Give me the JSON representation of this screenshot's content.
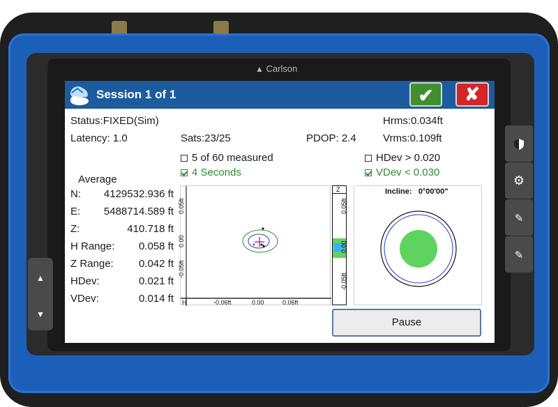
{
  "device": {
    "brand": "Carlson"
  },
  "titlebar": {
    "title": "Session 1 of 1"
  },
  "status": {
    "status": "Status:FIXED(Sim)",
    "latency": "Latency: 1.0",
    "sats": "Sats:23/25",
    "pdop": "PDOP: 2.4",
    "hrms": "Hrms:0.034ft",
    "vrms": "Vrms:0.109ft"
  },
  "criteria": {
    "measured": {
      "label": "5 of 60 measured",
      "checked": false
    },
    "seconds": {
      "label": "4 Seconds",
      "checked": true
    },
    "hdev": {
      "label": "HDev > 0.020",
      "checked": false
    },
    "vdev": {
      "label": "VDev < 0.030",
      "checked": true
    }
  },
  "average": {
    "heading": "Average",
    "rows": [
      {
        "label": "N:",
        "value": "4129532.936 ft"
      },
      {
        "label": "E:",
        "value": "5488714.589 ft"
      },
      {
        "label": "Z:",
        "value": "410.718 ft"
      },
      {
        "label": "H Range:",
        "value": "0.058 ft"
      },
      {
        "label": "Z Range:",
        "value": "0.042 ft"
      },
      {
        "label": "HDev:",
        "value": "0.021 ft"
      },
      {
        "label": "VDev:",
        "value": "0.014 ft"
      }
    ]
  },
  "scatter_plot": {
    "y_ticks": [
      "0.05ft",
      "0.00",
      "-0.05ft"
    ],
    "x_ticks": [
      "-0.06ft",
      "0.00",
      "0.06ft"
    ],
    "corner_label": "H"
  },
  "z_bar": {
    "top_label": "Z",
    "ticks": [
      "0.05ft",
      "0.00",
      "-0.05ft"
    ]
  },
  "incline": {
    "label": "Incline:",
    "value": "0°00'00\""
  },
  "actions": {
    "pause": "Pause"
  },
  "colors": {
    "titlebar": "#1c5b9e",
    "ok": "#3f8f2e",
    "cancel": "#d3262a",
    "device_body": "#1c5fb8",
    "incline_dot": "#5fd35f"
  }
}
